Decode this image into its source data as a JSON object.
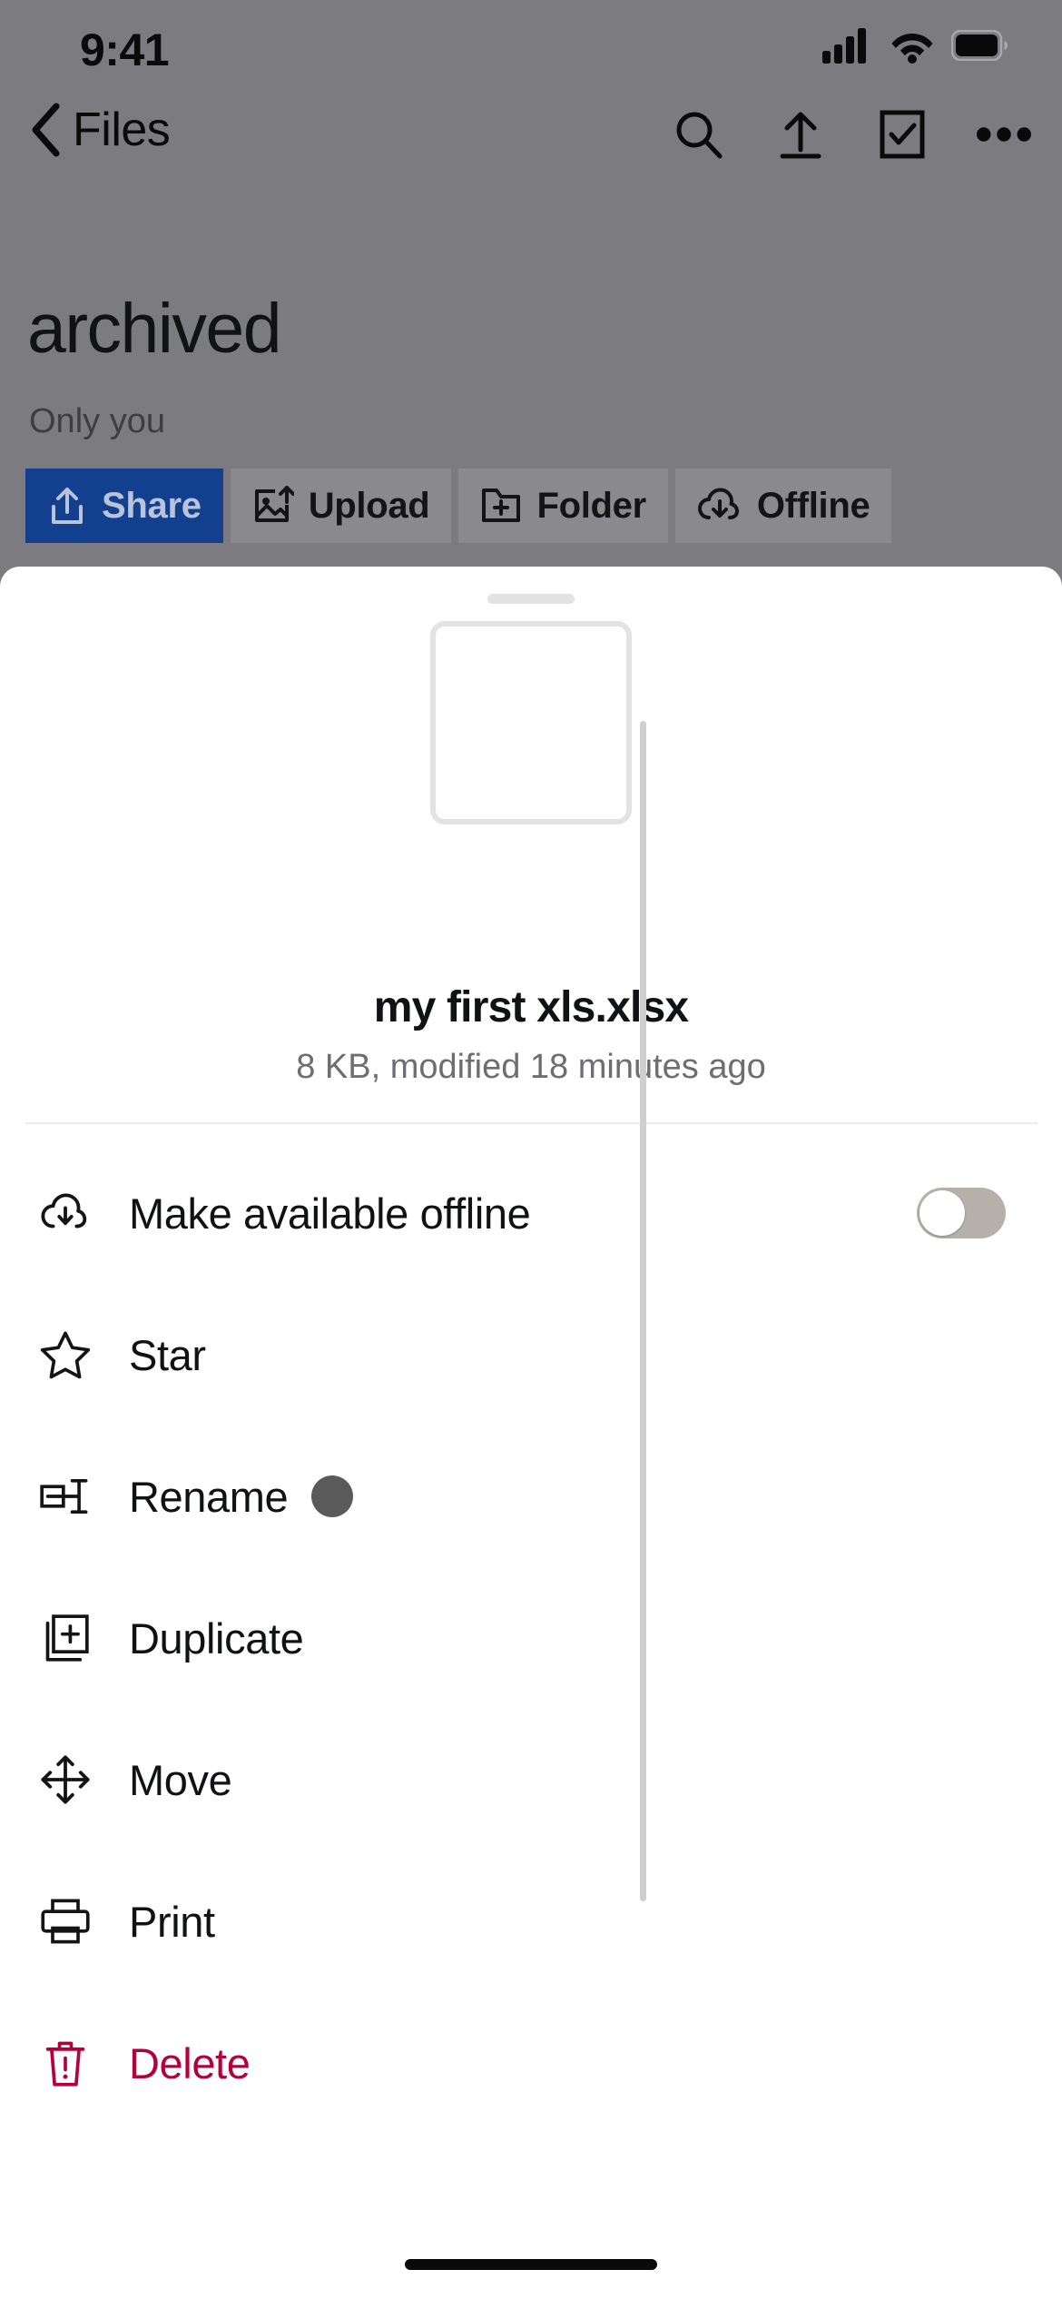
{
  "status_bar": {
    "time": "9:41",
    "icons": [
      "cellular-signal-icon",
      "wifi-icon",
      "battery-icon"
    ]
  },
  "nav_bar": {
    "back_label": "Files",
    "back_icon": "chevron-left-icon",
    "actions": [
      {
        "name": "search-icon",
        "label": "Search"
      },
      {
        "name": "upload-icon",
        "label": "Upload"
      },
      {
        "name": "select-checkbox-icon",
        "label": "Select"
      },
      {
        "name": "more-options-icon",
        "label": "More"
      }
    ]
  },
  "header": {
    "title": "archived",
    "subtitle": "Only you"
  },
  "action_chips": [
    {
      "label": "Share",
      "icon": "share-icon",
      "primary": true
    },
    {
      "label": "Upload",
      "icon": "image-upload-icon",
      "primary": false
    },
    {
      "label": "Folder",
      "icon": "folder-add-icon",
      "primary": false
    },
    {
      "label": "Offline",
      "icon": "cloud-download-icon",
      "primary": false
    }
  ],
  "sheet": {
    "file_name": "my first xls.xlsx",
    "file_meta": "8 KB, modified 18 minutes ago",
    "thumbnail": "file-thumbnail-placeholder",
    "menu": [
      {
        "label": "Make available offline",
        "icon": "cloud-download-icon",
        "control": "toggle",
        "toggle_on": false,
        "danger": false
      },
      {
        "label": "Star",
        "icon": "star-outline-icon",
        "control": "none",
        "danger": false
      },
      {
        "label": "Rename",
        "icon": "rename-icon",
        "control": "touch-dot",
        "danger": false
      },
      {
        "label": "Duplicate",
        "icon": "duplicate-icon",
        "control": "none",
        "danger": false
      },
      {
        "label": "Move",
        "icon": "move-arrows-icon",
        "control": "none",
        "danger": false
      },
      {
        "label": "Print",
        "icon": "printer-icon",
        "control": "none",
        "danger": false
      },
      {
        "label": "Delete",
        "icon": "trash-warning-icon",
        "control": "none",
        "danger": true
      }
    ]
  },
  "colors": {
    "primary_chip": "#133F8F",
    "danger": "#b5003c",
    "backdrop": "#7c7b80",
    "sheet_bg": "#ffffff"
  }
}
